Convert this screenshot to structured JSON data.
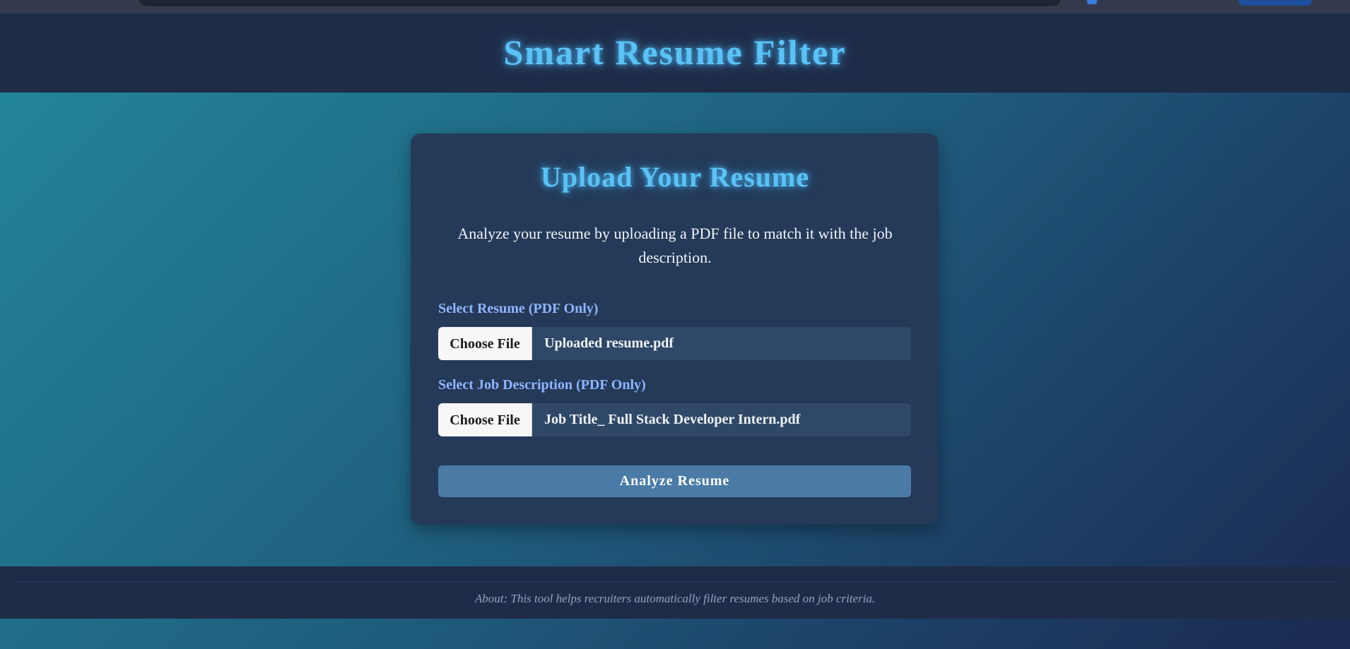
{
  "header": {
    "title": "Smart Resume Filter"
  },
  "upload_card": {
    "title": "Upload Your Resume",
    "description": "Analyze your resume by uploading a PDF file to match it with the job description.",
    "resume_field": {
      "label": "Select Resume (PDF Only)",
      "button_label": "Choose File",
      "file_name": "Uploaded resume.pdf"
    },
    "job_field": {
      "label": "Select Job Description (PDF Only)",
      "button_label": "Choose File",
      "file_name": "Job Title_ Full Stack Developer Intern.pdf"
    },
    "submit_label": "Analyze Resume"
  },
  "footer": {
    "about_text": "About: This tool helps recruiters automatically filter resumes based on job criteria."
  },
  "colors": {
    "accent_glow": "#5ac2f4",
    "label": "#90b4ff",
    "button": "#4a7ba6",
    "card": "#243a58",
    "header": "#1f2c48"
  }
}
